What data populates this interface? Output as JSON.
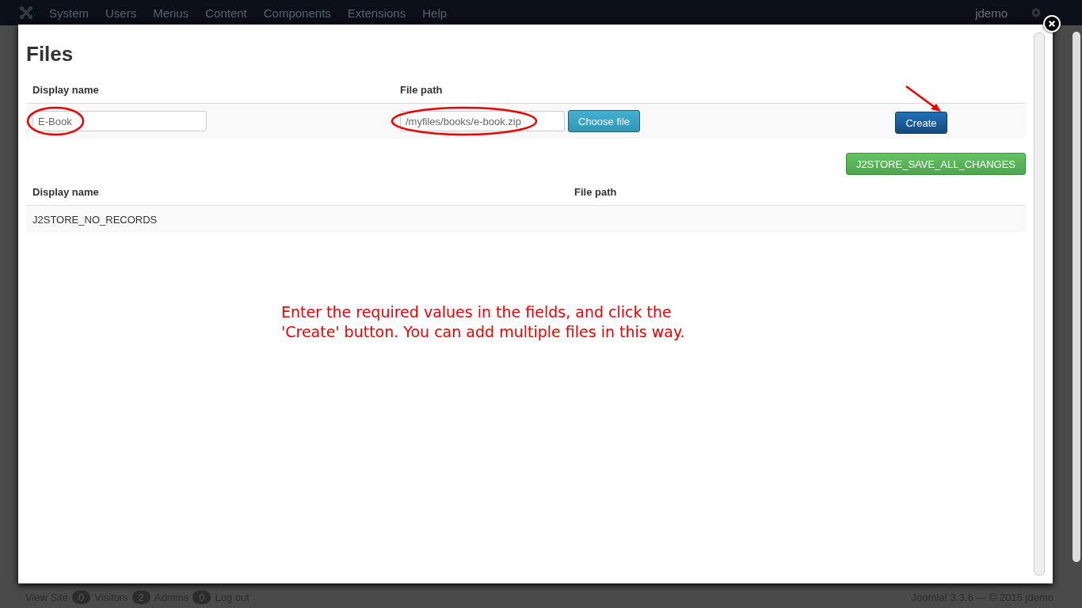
{
  "top_bar": {
    "menu": [
      "System",
      "Users",
      "Menus",
      "Content",
      "Components",
      "Extensions",
      "Help"
    ],
    "user": "jdemo"
  },
  "status_bar": {
    "view_site": "View Site",
    "counters": [
      {
        "count": "0",
        "label": "Visitors"
      },
      {
        "count": "2",
        "label": "Admins"
      },
      {
        "count": "0"
      }
    ],
    "logout": "Log out",
    "version": "Joomla! 3.3.6  —  © 2015 jdemo"
  },
  "modal": {
    "title": "Files",
    "form": {
      "columns": [
        "Display name",
        "File path"
      ],
      "display_name": {
        "value": "E-Book"
      },
      "file_path": {
        "value": "/myfiles/books/e-book.zip"
      },
      "choose_button": "Choose file",
      "create_button": "Create"
    },
    "save_button": "J2STORE_SAVE_ALL_CHANGES",
    "list": {
      "columns": [
        "Display name",
        "File path"
      ],
      "empty_text": "J2STORE_NO_RECORDS"
    },
    "annotation": "Enter the required values in the fields, and click the 'Create' button. You can add multiple files in this way."
  }
}
